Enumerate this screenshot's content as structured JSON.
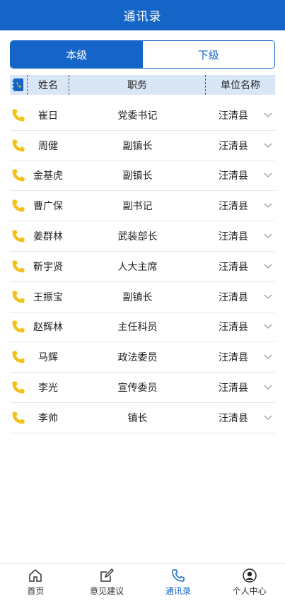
{
  "header": {
    "title": "通讯录"
  },
  "segment": {
    "current_label": "本级",
    "sub_label": "下级"
  },
  "table": {
    "headers": {
      "name": "姓名",
      "post": "职务",
      "unit": "单位名称"
    },
    "rows": [
      {
        "name": "崔日",
        "post": "党委书记",
        "unit": "汪清县"
      },
      {
        "name": "周健",
        "post": "副镇长",
        "unit": "汪清县"
      },
      {
        "name": "金基虎",
        "post": "副镇长",
        "unit": "汪清县"
      },
      {
        "name": "曹广保",
        "post": "副书记",
        "unit": "汪清县"
      },
      {
        "name": "姜群林",
        "post": "武装部长",
        "unit": "汪清县"
      },
      {
        "name": "靳宇贤",
        "post": "人大主席",
        "unit": "汪清县"
      },
      {
        "name": "王振宝",
        "post": "副镇长",
        "unit": "汪清县"
      },
      {
        "name": "赵辉林",
        "post": "主任科员",
        "unit": "汪清县"
      },
      {
        "name": "马辉",
        "post": "政法委员",
        "unit": "汪清县"
      },
      {
        "name": "李光",
        "post": "宣传委员",
        "unit": "汪清县"
      },
      {
        "name": "李帅",
        "post": "镇长",
        "unit": "汪清县"
      }
    ]
  },
  "tabbar": {
    "items": [
      {
        "label": "首页",
        "icon": "home-icon"
      },
      {
        "label": "意见建议",
        "icon": "edit-icon"
      },
      {
        "label": "通讯录",
        "icon": "phone-icon"
      },
      {
        "label": "个人中心",
        "icon": "user-icon"
      }
    ],
    "active": "通讯录"
  },
  "colors": {
    "primary": "#1565c8",
    "phone_icon": "#f3c11a",
    "header_row_bg": "#d8e6f6"
  }
}
